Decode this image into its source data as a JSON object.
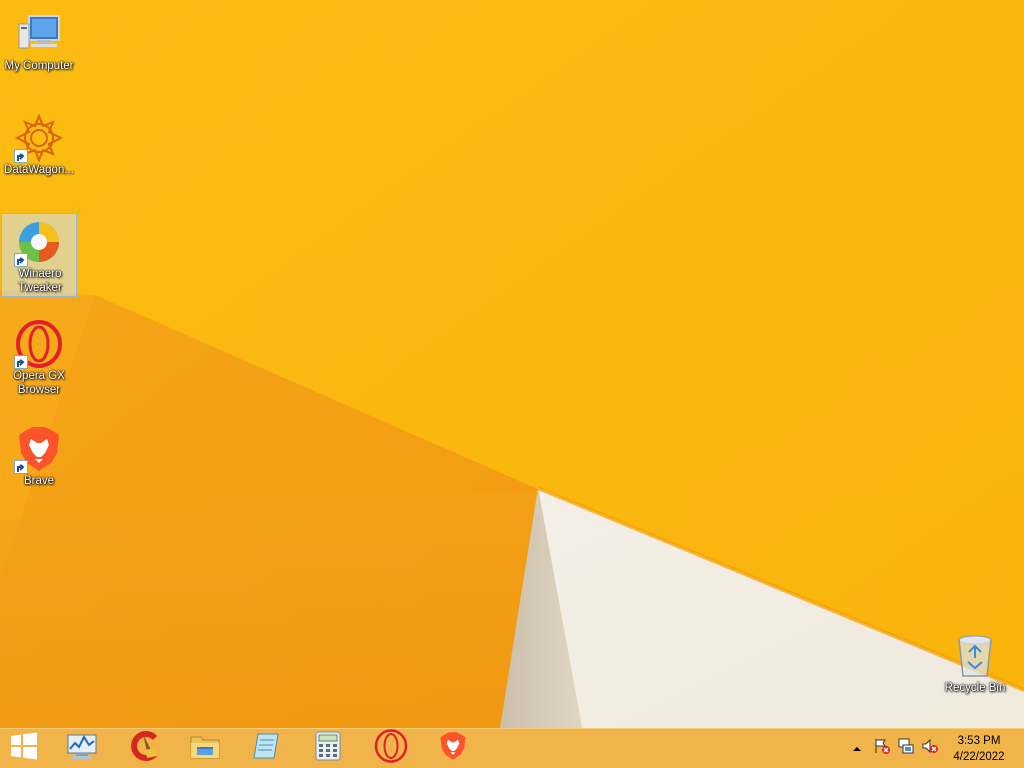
{
  "desktop": {
    "icons": [
      {
        "label": "My Computer",
        "icon": "computer-icon",
        "shortcut": false
      },
      {
        "label": "DataWagon...",
        "icon": "datawagon-icon",
        "shortcut": true
      },
      {
        "label": "Winaero Tweaker",
        "icon": "winaero-tweaker-icon",
        "shortcut": true,
        "selected": true
      },
      {
        "label": "Opera GX Browser",
        "icon": "opera-gx-icon",
        "shortcut": true
      },
      {
        "label": "Brave",
        "icon": "brave-icon",
        "shortcut": true
      },
      {
        "label": "Recycle Bin",
        "icon": "recycle-bin-icon",
        "shortcut": false
      }
    ]
  },
  "taskbar": {
    "pinned": [
      {
        "name": "start-button",
        "icon": "windows-logo-icon"
      },
      {
        "name": "performance-monitor",
        "icon": "performance-monitor-icon"
      },
      {
        "name": "ccleaner",
        "icon": "ccleaner-icon"
      },
      {
        "name": "file-explorer",
        "icon": "folder-icon"
      },
      {
        "name": "notepad",
        "icon": "notepad-icon"
      },
      {
        "name": "calculator",
        "icon": "calculator-icon"
      },
      {
        "name": "opera",
        "icon": "opera-icon"
      },
      {
        "name": "brave",
        "icon": "brave-icon"
      }
    ],
    "tray": {
      "icons": [
        "show-hidden-icons-arrow",
        "action-center-flag-icon",
        "network-icon",
        "volume-muted-icon"
      ],
      "time": "3:53 PM",
      "date": "4/22/2022"
    }
  },
  "colors": {
    "wallpaper": "#f9b710",
    "taskbar": "#f0b44a",
    "opera": "#e0202a",
    "brave": "#fb542b"
  }
}
